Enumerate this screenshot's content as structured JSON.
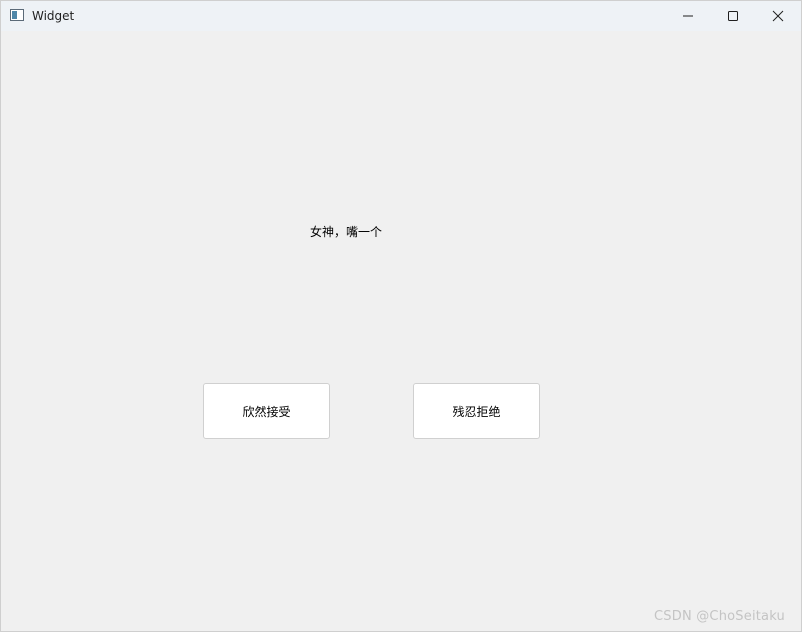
{
  "window": {
    "title": "Widget",
    "controls": {
      "minimize_icon": "minimize-icon",
      "maximize_icon": "maximize-icon",
      "close_icon": "close-icon"
    }
  },
  "main": {
    "message": "女神，嘴一个",
    "accept_label": "欣然接受",
    "reject_label": "残忍拒绝"
  },
  "watermark": "CSDN @ChoSeitaku",
  "colors": {
    "window_background": "#f0f0f0",
    "titlebar_background": "#eef2f6",
    "button_background": "#ffffff",
    "button_border": "#d0d0d0"
  }
}
